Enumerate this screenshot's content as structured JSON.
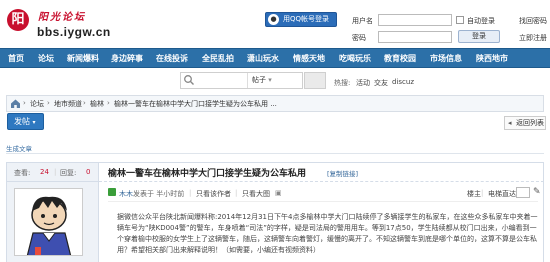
{
  "site": {
    "name": "阳光论坛",
    "domain": "bbs.iygw.cn",
    "logo_char": "阳"
  },
  "login": {
    "qq_label": "用QQ帐号登录",
    "username_label": "用户名",
    "password_label": "密码",
    "auto_login_label": "自动登录",
    "login_button": "登录",
    "retrieve_password": "找回密码",
    "register": "立即注册"
  },
  "nav": [
    "首页",
    "论坛",
    "新闻爆料",
    "身边碎事",
    "在线投诉",
    "全民乱拍",
    "潇山玩水",
    "情感天地",
    "吃喝玩乐",
    "教育校园",
    "市场信息",
    "陕西地市"
  ],
  "search": {
    "placeholder": "请输入搜索内容",
    "scope": "帖子",
    "hot_label": "热搜:",
    "hot_items": [
      "活动",
      "交友",
      "discuz"
    ]
  },
  "breadcrumb": [
    "论坛",
    "地市频道",
    "榆林",
    "榆林一警车在榆林中学大门口接学生疑为公车私用 ..."
  ],
  "actions": {
    "post_button": "发帖",
    "back_button": "返回列表"
  },
  "category": "生成文章",
  "thread": {
    "view_label": "查看:",
    "views": "24",
    "reply_label": "回复:",
    "replies": "0",
    "title": "榆林一警车在榆林中学大门口接学生疑为公车私用",
    "copy_link": "[复制链接]",
    "author": "木木",
    "published": "发表于 半小时前",
    "only_author": "只看该作者",
    "only_large_image": "只看大图",
    "floor_label": "楼主",
    "reader_mode": "电梯直达",
    "body": "据微信公众平台陕北新闻爆料称:2014年12月31日下午4点多榆林中学大门口陆续停了多辆接学生的私家车，在这些众多私家车中夹着一辆车号为“陕KD004警”的警车，车身喷着“司法”的字样，疑是司法局的警用用车。等到17点50，学生陆续都从校门口出来，小编看到一个穿着榆中校服的女学生上了这辆警车，随后，这辆警车向着警灯，缓慢的离开了。不知这辆警车到底是哪个单位的，这算不算是公车私用？希望相关部门出来解释说明！（如需要，小编还有视频资料）"
  }
}
